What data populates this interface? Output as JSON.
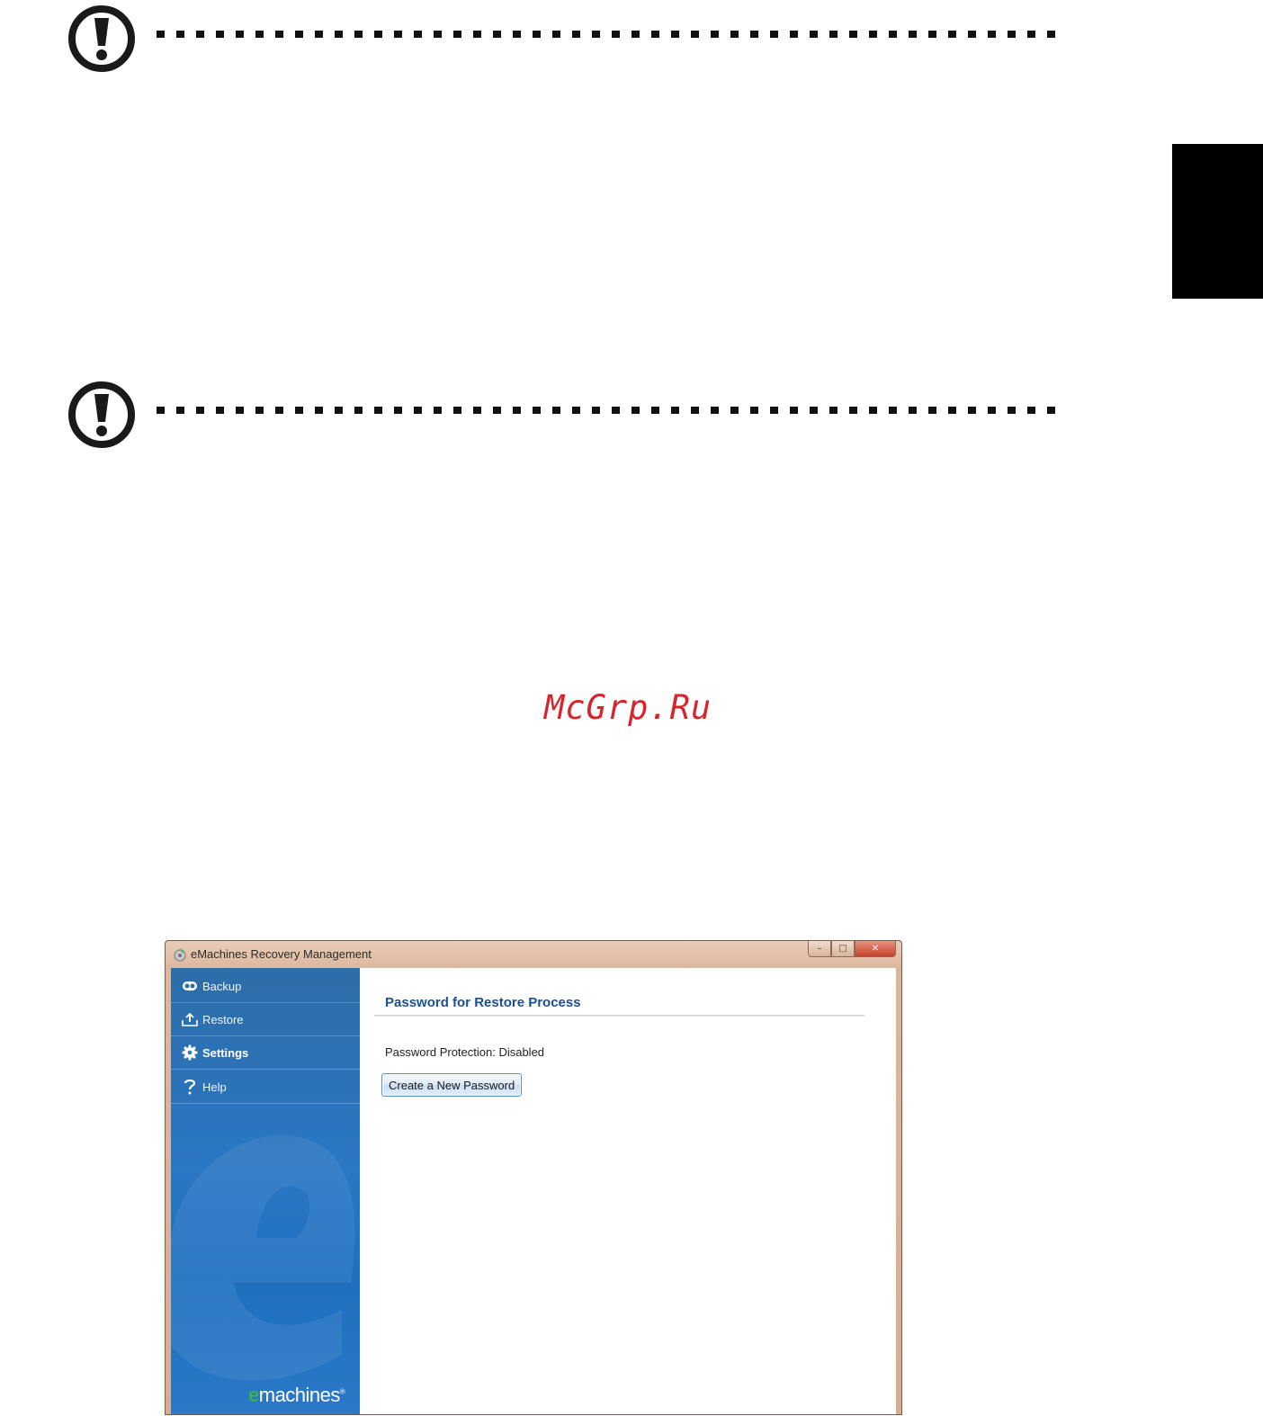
{
  "watermark": "McGrp.Ru",
  "window": {
    "title": "eMachines Recovery Management",
    "controls": {
      "minimize": "–",
      "maximize": "□",
      "close": "✕"
    },
    "sidebar": {
      "items": [
        {
          "label": "Backup",
          "icon": "backup-icon",
          "active": false
        },
        {
          "label": "Restore",
          "icon": "restore-icon",
          "active": false
        },
        {
          "label": "Settings",
          "icon": "gear-icon",
          "active": true
        },
        {
          "label": "Help",
          "icon": "help-icon",
          "active": false
        }
      ],
      "brand_e": "e",
      "brand_text": "machines",
      "brand_mark": "®"
    },
    "main": {
      "title": "Password for Restore Process",
      "status": "Password Protection: Disabled",
      "button_label": "Create a New Password"
    }
  },
  "colors": {
    "sidebar_blue": "#2a77c4",
    "title_blue": "#1b4f8e",
    "watermark_red": "#d9232a",
    "brand_green": "#3fb14b"
  }
}
